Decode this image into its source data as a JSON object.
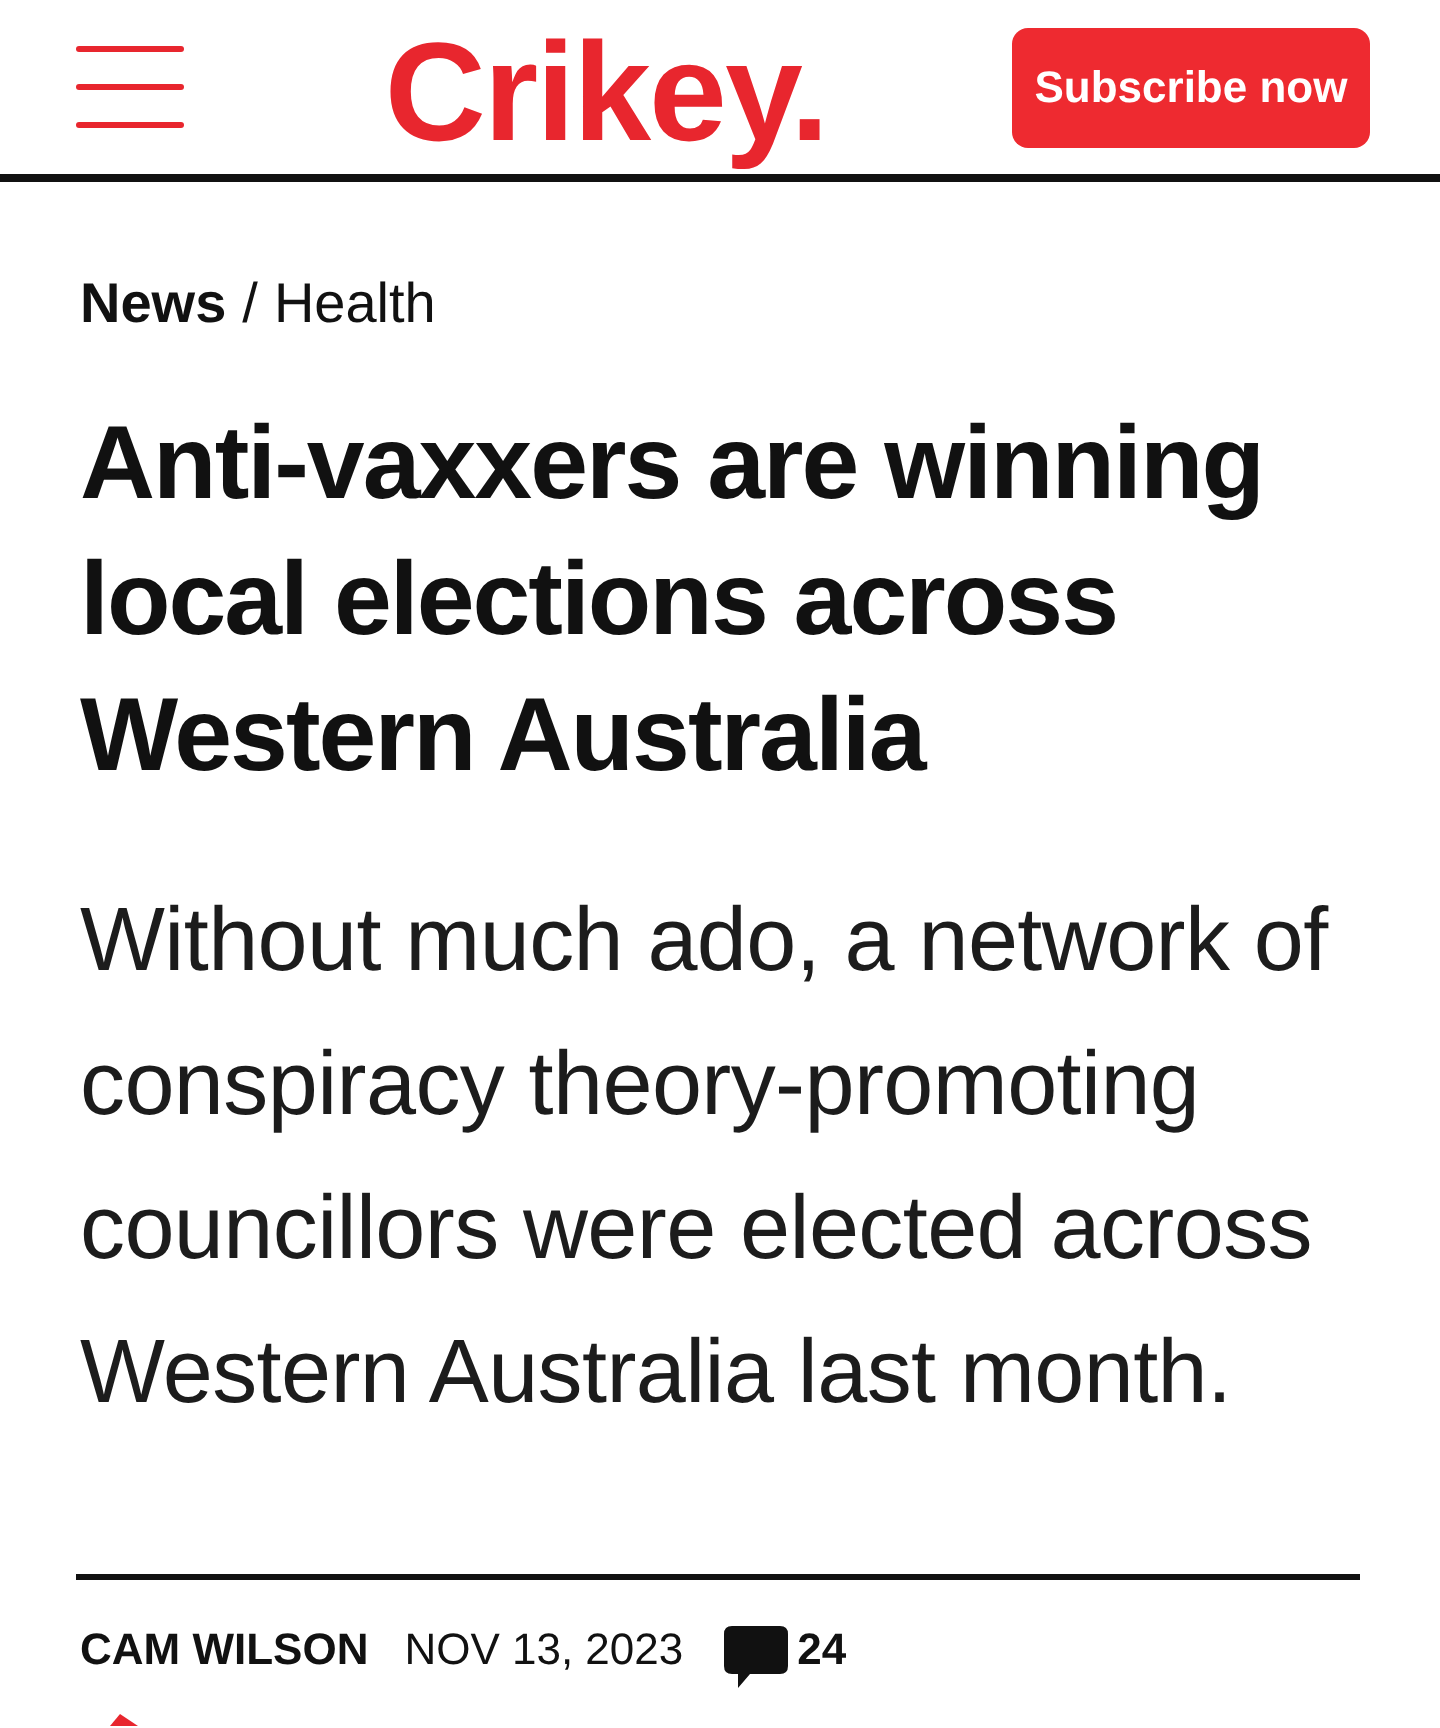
{
  "header": {
    "logo": "Crikey.",
    "subscribe_button": "Subscribe now"
  },
  "breadcrumb": {
    "items": [
      "News",
      "Health"
    ],
    "separator": "/"
  },
  "headline": "Anti-vaxxers are winning local elections across Western Australia",
  "standfirst": "Without much ado, a network of conspiracy theory-promoting councillors were elected across Western Australia last month.",
  "byline": {
    "author": "CAM WILSON",
    "date": "NOV 13, 2023",
    "comment_count": "24"
  }
}
